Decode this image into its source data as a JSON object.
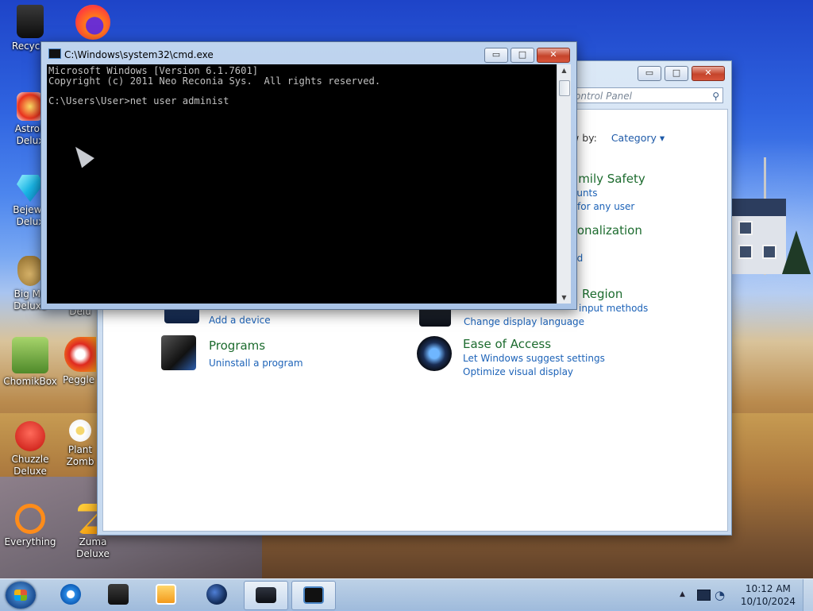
{
  "desktop": {
    "icons": [
      {
        "label": "Recycle",
        "icon": "recycle-bin-icon"
      },
      {
        "label": "",
        "icon": "firefox-icon"
      },
      {
        "label": "AstroP Delux",
        "icon": "astropop-icon"
      },
      {
        "label": "Bejewe Delux",
        "icon": "bejeweled-icon"
      },
      {
        "label": "Big Mo Deluxe",
        "icon": "big-money-icon"
      },
      {
        "label": "Delu",
        "icon": "game-icon"
      },
      {
        "label": "ChomikBox",
        "icon": "chomikbox-icon"
      },
      {
        "label": "Peggle \\ of Warc",
        "icon": "peggle-icon"
      },
      {
        "label": "Chuzzle Deluxe",
        "icon": "chuzzle-icon"
      },
      {
        "label": "Plant Zomb",
        "icon": "plants-zombies-icon"
      },
      {
        "label": "Everything",
        "icon": "everything-search-icon"
      },
      {
        "label": "Zuma Deluxe",
        "icon": "zuma-icon"
      }
    ]
  },
  "control_panel": {
    "search_placeholder": "ontrol Panel",
    "view_by_label": "w by:",
    "view_by_value": "Category",
    "categories": [
      {
        "title": "amily Safety",
        "links": [
          "ounts",
          "for any user"
        ]
      },
      {
        "title": "sonalization",
        "links": [
          "nd"
        ]
      },
      {
        "title": "Region",
        "links": [
          "input methods",
          "Change display language"
        ]
      },
      {
        "title": "",
        "links": [
          "Add a device"
        ]
      },
      {
        "title": "Programs",
        "links": [
          "Uninstall a program"
        ]
      },
      {
        "title": "Ease of Access",
        "links": [
          "Let Windows suggest settings",
          "Optimize visual display"
        ]
      }
    ],
    "buttons": {
      "minimize": "▭",
      "maximize": "□",
      "close": "✕"
    }
  },
  "cmd": {
    "title": "C:\\Windows\\system32\\cmd.exe",
    "lines": [
      "Microsoft Windows [Version 6.1.7601]",
      "Copyright (c) 2011 Neo Reconia Sys.  All rights reserved.",
      "",
      "C:\\Users\\User>net user administ"
    ],
    "buttons": {
      "minimize": "▭",
      "maximize": "□",
      "close": "✕"
    }
  },
  "taskbar": {
    "items": [
      {
        "name": "internet-explorer",
        "icon": "internet-explorer-icon"
      },
      {
        "name": "windows-explorer",
        "icon": "folder-icon"
      },
      {
        "name": "media-player",
        "icon": "media-player-icon"
      },
      {
        "name": "globe-app",
        "icon": "globe-icon"
      },
      {
        "name": "control-panel",
        "icon": "control-panel-icon"
      },
      {
        "name": "cmd",
        "icon": "cmd-icon"
      }
    ],
    "clock": {
      "time": "10:12 AM",
      "date": "10/10/2024"
    }
  }
}
